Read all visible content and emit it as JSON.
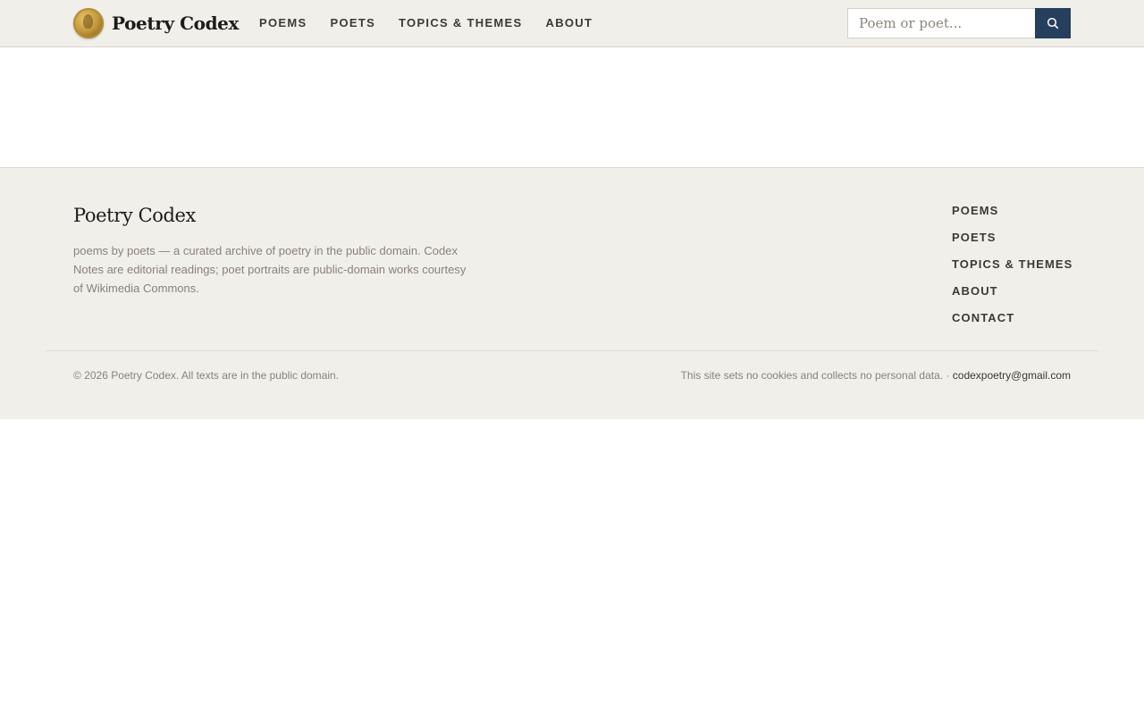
{
  "header": {
    "brand": "Poetry Codex",
    "nav": [
      {
        "label": "POEMS"
      },
      {
        "label": "POETS"
      },
      {
        "label": "TOPICS & THEMES"
      },
      {
        "label": "ABOUT"
      }
    ],
    "search": {
      "placeholder": "Poem or poet...",
      "icon": "search-icon"
    }
  },
  "footer": {
    "brand": "Poetry Codex",
    "description": "poems by poets — a curated archive of poetry in the public domain. Codex Notes are editorial readings; poet portraits are public-domain works courtesy of Wikimedia Commons.",
    "nav": [
      {
        "label": "POEMS"
      },
      {
        "label": "POETS"
      },
      {
        "label": "TOPICS & THEMES"
      },
      {
        "label": "ABOUT"
      },
      {
        "label": "CONTACT"
      }
    ],
    "copyright": "© 2026 Poetry Codex. All texts are in the public domain.",
    "privacy_text": "This site sets no cookies and collects no personal data. · ",
    "email": "codexpoetry@gmail.com"
  },
  "colors": {
    "header_bg": "#f1efea",
    "search_button": "#263f5c",
    "footer_bg": "#f1efea"
  }
}
